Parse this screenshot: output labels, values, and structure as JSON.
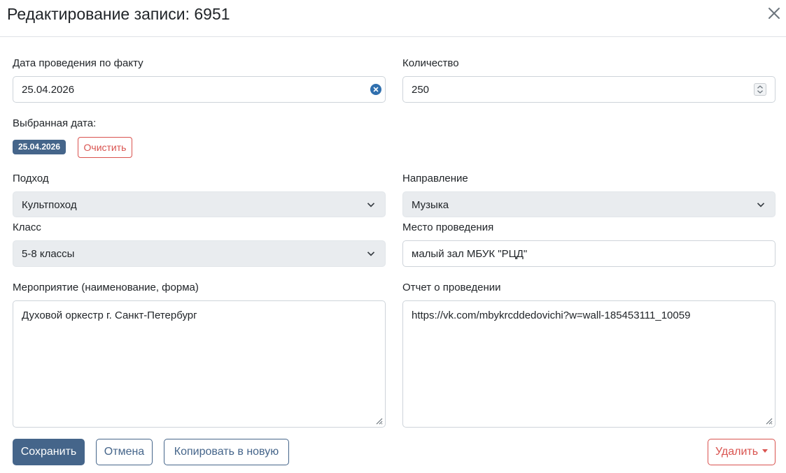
{
  "header": {
    "title": "Редактирование записи: 6951"
  },
  "fields": {
    "date": {
      "label": "Дата проведения по факту",
      "value": "25.04.2026"
    },
    "quantity": {
      "label": "Количество",
      "value": "250"
    },
    "selected_date": {
      "label": "Выбранная дата:",
      "badge": "25.04.2026",
      "clear_label": "Очистить"
    },
    "approach": {
      "label": "Подход",
      "value": "Культпоход"
    },
    "direction": {
      "label": "Направление",
      "value": "Музыка"
    },
    "class": {
      "label": "Класс",
      "value": "5-8 классы"
    },
    "venue": {
      "label": "Место проведения",
      "value": "малый зал МБУК \"РЦД\""
    },
    "event": {
      "label": "Мероприятие (наименование, форма)",
      "value": "Духовой оркестр г. Санкт-Петербург"
    },
    "report": {
      "label": "Отчет о проведении",
      "value": "https://vk.com/mbykrcddedovichi?w=wall-185453111_10059"
    }
  },
  "buttons": {
    "save": "Сохранить",
    "cancel": "Отмена",
    "copy": "Копировать в новую",
    "delete": "Удалить"
  },
  "colors": {
    "primary": "#45658a",
    "danger": "#d9534f",
    "select_bg": "#e9ecef"
  },
  "icons": {
    "close": "close-icon",
    "clear": "clear-circle-icon",
    "spin": "spinner-icon",
    "chevron": "chevron-down-icon",
    "grip": "resize-grip-icon"
  }
}
